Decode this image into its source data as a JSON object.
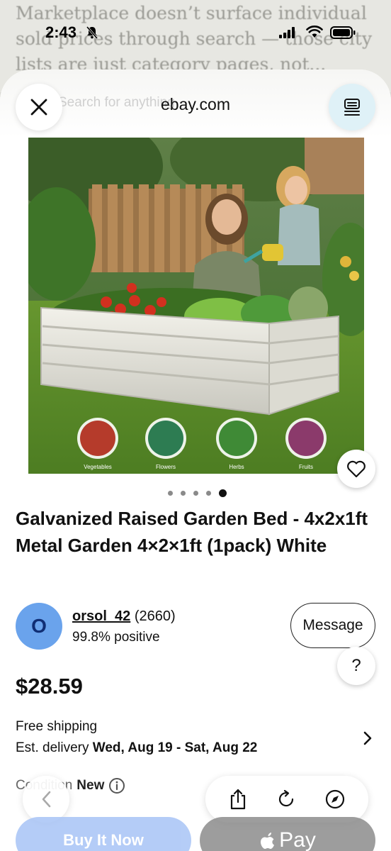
{
  "background_page": {
    "lines": [
      "Marketplace doesn’t surface individual",
      "sold prices through search — those city",
      "lists are just category pages, not..."
    ]
  },
  "status_bar": {
    "time": "2:43"
  },
  "header": {
    "site": "ebay.com",
    "ghost_search": "Search for anything"
  },
  "product": {
    "image_badges": [
      "Vegetables",
      "Flowers",
      "Herbs",
      "Fruits"
    ],
    "carousel": {
      "count": 5,
      "active_index": 4
    },
    "title": "Galvanized Raised Garden Bed - 4x2x1ft Metal Garden 4×2×1ft (1pack) White",
    "price": "$28.59"
  },
  "seller": {
    "initial": "O",
    "name": "orsol_42",
    "count": "(2660)",
    "feedback": "99.8% positive",
    "message_label": "Message",
    "help_label": "?"
  },
  "shipping": {
    "free": "Free shipping",
    "eta_label": "Est. delivery",
    "eta_dates": "Wed, Aug 19 - Sat, Aug 22"
  },
  "condition": {
    "label": "Condition",
    "value": "New"
  },
  "actions": {
    "buy_now": "Buy It Now",
    "pay": "Pay"
  },
  "colors": {
    "accent_blue": "#3665f3",
    "avatar": "#6aa3ec",
    "reader_button": "#dff1f7"
  },
  "icons": [
    "bell-slash-icon",
    "signal-icon",
    "wifi-icon",
    "battery-icon",
    "close-icon",
    "reader-icon",
    "heart-icon",
    "chevron-right-icon",
    "info-icon",
    "back-icon",
    "share-icon",
    "reload-icon",
    "compass-icon",
    "apple-icon"
  ]
}
